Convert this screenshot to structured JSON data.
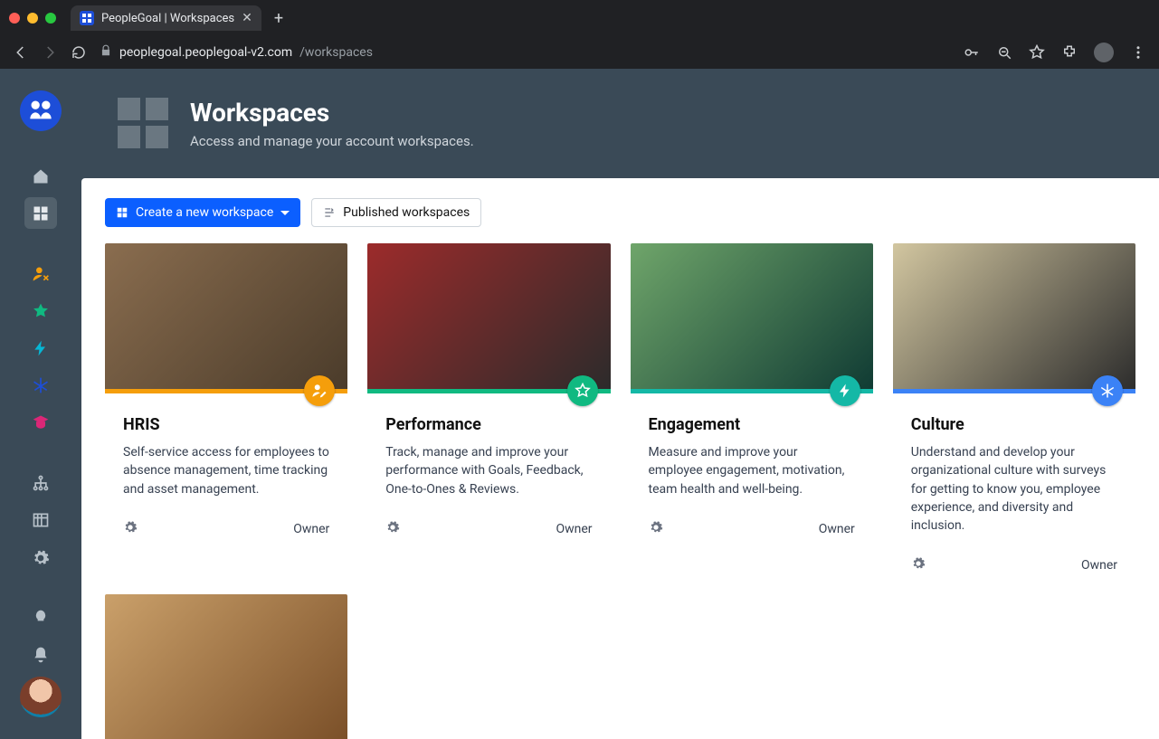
{
  "browser": {
    "tab_title": "PeopleGoal | Workspaces",
    "host": "peoplegoal.peoplegoal-v2.com",
    "path": "/workspaces"
  },
  "header": {
    "title": "Workspaces",
    "subtitle": "Access and manage your account workspaces."
  },
  "toolbar": {
    "create_label": "Create a new workspace",
    "published_label": "Published workspaces"
  },
  "sidebar": {
    "items": [
      {
        "name": "home",
        "color": "#b7c1c9"
      },
      {
        "name": "workspaces",
        "color": "#e5e9ec",
        "active": true
      },
      {
        "name": "people",
        "color": "#f59e0b"
      },
      {
        "name": "favorites",
        "color": "#10b981"
      },
      {
        "name": "automations",
        "color": "#06b6d4"
      },
      {
        "name": "asterisk",
        "color": "#1d4ed8"
      },
      {
        "name": "learning",
        "color": "#db2777"
      },
      {
        "name": "org",
        "color": "#b7c1c9"
      },
      {
        "name": "reports",
        "color": "#b7c1c9"
      },
      {
        "name": "settings",
        "color": "#b7c1c9"
      },
      {
        "name": "ideas",
        "color": "#b7c1c9"
      },
      {
        "name": "notifications",
        "color": "#b7c1c9"
      }
    ]
  },
  "cards": [
    {
      "title": "HRIS",
      "desc": "Self-service access for employees to absence management, time tracking and asset management.",
      "role": "Owner",
      "accent": "#f59e0b",
      "badge": "person-pen",
      "image": "img1"
    },
    {
      "title": "Performance",
      "desc": "Track, manage and improve your performance with Goals, Feedback, One-to-Ones & Reviews.",
      "role": "Owner",
      "accent": "#10b981",
      "badge": "star",
      "image": "img2"
    },
    {
      "title": "Engagement",
      "desc": "Measure and improve your employee engagement, motivation, team health and well-being.",
      "role": "Owner",
      "accent": "#14b8a6",
      "badge": "bolt",
      "image": "img3"
    },
    {
      "title": "Culture",
      "desc": "Understand and develop your organizational culture with surveys for getting to know you, employee experience, and diversity and inclusion.",
      "role": "Owner",
      "accent": "#3b82f6",
      "badge": "asterisk",
      "image": "img4"
    },
    {
      "title": "",
      "desc": "",
      "role": "",
      "accent": "",
      "badge": "",
      "image": "img5",
      "imageOnly": true
    }
  ]
}
